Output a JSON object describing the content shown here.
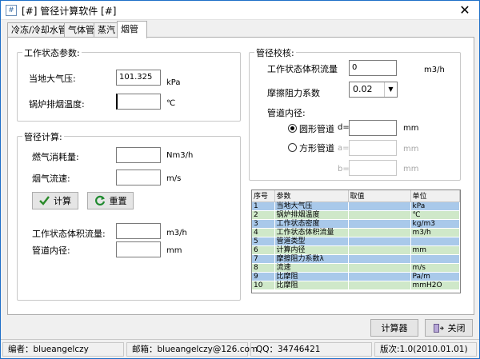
{
  "window": {
    "title": "[#] 管径计算软件 [#]",
    "icon_text": "#",
    "close_label": "✕"
  },
  "tabs": [
    "冷冻/冷却水管",
    "气体管",
    "蒸汽",
    "烟管"
  ],
  "work": {
    "title": "工作状态参数:",
    "pressure_label": "当地大气压:",
    "pressure_value": "101.325",
    "pressure_unit": "kPa",
    "temp_label": "锅炉排烟温度:",
    "temp_value": "",
    "temp_unit": "℃"
  },
  "calc": {
    "title": "管径计算:",
    "fuel_label": "燃气消耗量:",
    "fuel_value": "",
    "fuel_unit": "Nm3/h",
    "speed_label": "烟气流速:",
    "speed_value": "",
    "speed_unit": "m/s",
    "calc_btn": "计算",
    "reset_btn": "重置",
    "flow_label": "工作状态体积流量:",
    "flow_value": "",
    "flow_unit": "m3/h",
    "diam_label": "管道内径:",
    "diam_value": "",
    "diam_unit": "mm"
  },
  "check": {
    "title": "管径校核:",
    "flow_label": "工作状态体积流量",
    "flow_value": "0",
    "flow_unit": "m3/h",
    "friction_label": "摩擦阻力系数",
    "friction_value": "0.02",
    "diam_label": "管道内径:",
    "round_label": "圆形管道",
    "round_var": "d=",
    "round_unit": "mm",
    "square_label": "方形管道",
    "square_var_a": "a=",
    "square_var_b": "b=",
    "square_unit_a": "mm",
    "square_unit_b": "mm"
  },
  "results": {
    "headers": [
      "序号",
      "参数",
      "取值",
      "单位"
    ],
    "rows": [
      [
        "1",
        "当地大气压",
        "",
        "kPa"
      ],
      [
        "2",
        "锅炉排烟温度",
        "",
        "℃"
      ],
      [
        "3",
        "工作状态密度",
        "",
        "kg/m3"
      ],
      [
        "4",
        "工作状态体积流量",
        "",
        "m3/h"
      ],
      [
        "5",
        "管道类型",
        "",
        ""
      ],
      [
        "6",
        "计算内径",
        "",
        "mm"
      ],
      [
        "7",
        "摩擦阻力系数λ",
        "",
        ""
      ],
      [
        "8",
        "流速",
        "",
        "m/s"
      ],
      [
        "9",
        "比摩阻",
        "",
        "Pa/m"
      ],
      [
        "10",
        "比摩阻",
        "",
        "mmH2O"
      ]
    ]
  },
  "footer_buttons": {
    "calculator": "计算器",
    "close": "关闭"
  },
  "status": {
    "editor": "编者：blueangelczy",
    "email": "邮箱：blueangelczy@126.com",
    "qq": "QQ：34746421",
    "version": "版次:1.0(2010.01.01)"
  }
}
